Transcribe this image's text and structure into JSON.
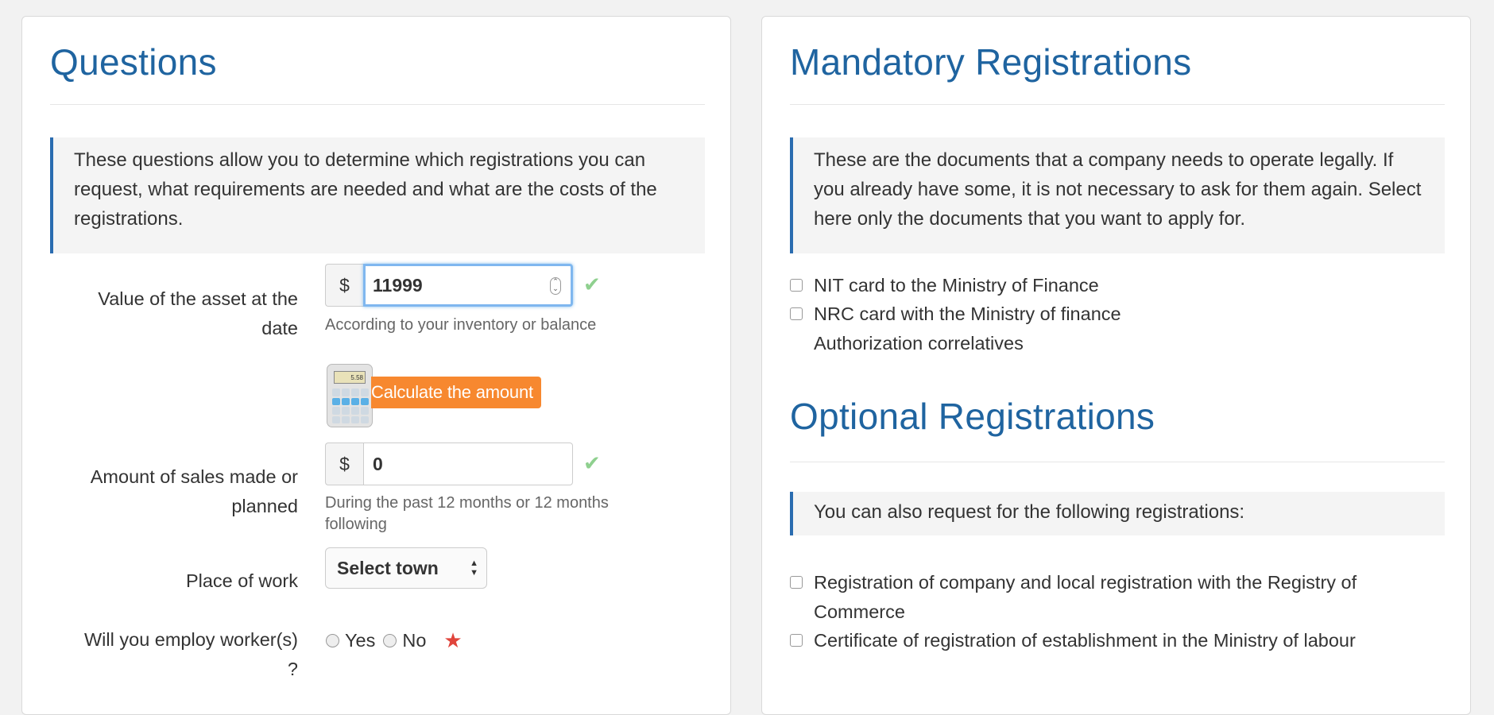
{
  "questions": {
    "title": "Questions",
    "intro": "These questions allow you to determine which registrations you can request, what requirements are needed and what are the costs of the registrations.",
    "asset": {
      "label": "Value of the asset at the date",
      "currency": "$",
      "value": "11999",
      "help": "According to your inventory or balance"
    },
    "calculate_label": "Calculate the amount",
    "calculator_display": "5.58",
    "sales": {
      "label": "Amount of sales made or planned",
      "currency": "$",
      "value": "0",
      "help": "During the past 12 months or 12 months following"
    },
    "place": {
      "label": "Place of work",
      "selected": "Select town"
    },
    "employ": {
      "label": "Will you employ worker(s) ?",
      "yes": "Yes",
      "no": "No",
      "required_mark": "★"
    },
    "valid_mark": "✔"
  },
  "mandatory": {
    "title": "Mandatory Registrations",
    "intro": "These are the documents that a company needs to operate legally. If you already have some, it is not necessary to ask for them again. Select here only the documents that you want to apply for.",
    "items": [
      {
        "label": "NIT card to the Ministry of Finance",
        "checked": false
      },
      {
        "label": "NRC card with the Ministry of finance",
        "checked": false
      }
    ],
    "sub_item": "Authorization correlatives"
  },
  "optional": {
    "title": "Optional Registrations",
    "intro": "You can also request for the following registrations:",
    "items": [
      {
        "label": "Registration of company and local registration with the Registry of Commerce",
        "checked": false
      },
      {
        "label": "Certificate of registration of establishment in the Ministry of labour",
        "checked": false
      }
    ]
  },
  "colors": {
    "heading": "#1f64a0",
    "accent_border": "#2a6cb0",
    "calculate_button": "#f7882f",
    "valid_check": "#8fd08f",
    "required_star": "#e0443b",
    "focus_ring": "#7fb7ef"
  }
}
